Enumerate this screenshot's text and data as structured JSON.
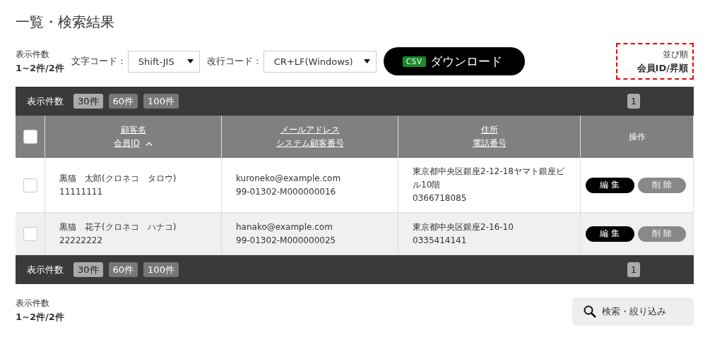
{
  "title": "一覧・検索結果",
  "count_top": {
    "label": "表示件数",
    "value": "1~2件/2件"
  },
  "encoding_select": {
    "label": "文字コード：",
    "value": "Shift-JIS"
  },
  "newline_select": {
    "label": "改行コード：",
    "value": "CR+LF(Windows)"
  },
  "download_button": {
    "badge": "CSV",
    "label": "ダウンロード"
  },
  "sort": {
    "label": "並び順",
    "value": "会員ID/昇順"
  },
  "pager_top": {
    "label": "表示件数",
    "sizes": [
      {
        "label": "30件",
        "selected": true
      },
      {
        "label": "60件",
        "selected": false
      },
      {
        "label": "100件",
        "selected": false
      }
    ],
    "pages": [
      {
        "label": "1",
        "selected": true
      }
    ]
  },
  "table": {
    "select_all": {
      "checked": false
    },
    "columns": [
      {
        "lines": [
          "顧客名",
          "会員ID"
        ],
        "link": true,
        "sorted": true
      },
      {
        "lines": [
          "メールアドレス",
          "システム顧客番号"
        ],
        "link": true,
        "sorted": false
      },
      {
        "lines": [
          "住所",
          "電話番号"
        ],
        "link": true,
        "sorted": false
      },
      {
        "lines": [
          "操作"
        ],
        "link": false,
        "sorted": false
      }
    ],
    "rows": [
      {
        "checked": false,
        "name": "黒猫　太郎(クロネコ　タロウ)",
        "member_id": "11111111",
        "email": "kuroneko@example.com",
        "system_no": "99-01302-M000000016",
        "address": "東京都中央区銀座2-12-18ヤマト銀座ビル10階",
        "phone": "0366718085",
        "actions": [
          {
            "label": "編 集",
            "kind": "primary"
          },
          {
            "label": "削 除",
            "kind": "secondary"
          }
        ]
      },
      {
        "checked": false,
        "name": "黒猫　花子(クロネコ　ハナコ)",
        "member_id": "22222222",
        "email": "hanako@example.com",
        "system_no": "99-01302-M000000025",
        "address": "東京都中央区銀座2-16-10",
        "phone": "0335414141",
        "actions": [
          {
            "label": "編 集",
            "kind": "primary"
          },
          {
            "label": "削 除",
            "kind": "secondary"
          }
        ]
      }
    ]
  },
  "pager_bottom": {
    "label": "表示件数",
    "sizes": [
      {
        "label": "30件",
        "selected": true
      },
      {
        "label": "60件",
        "selected": false
      },
      {
        "label": "100件",
        "selected": false
      }
    ],
    "pages": [
      {
        "label": "1",
        "selected": true
      }
    ]
  },
  "count_bottom": {
    "label": "表示件数",
    "value": "1~2件/2件"
  },
  "search_button": {
    "label": "検索・絞り込み"
  }
}
